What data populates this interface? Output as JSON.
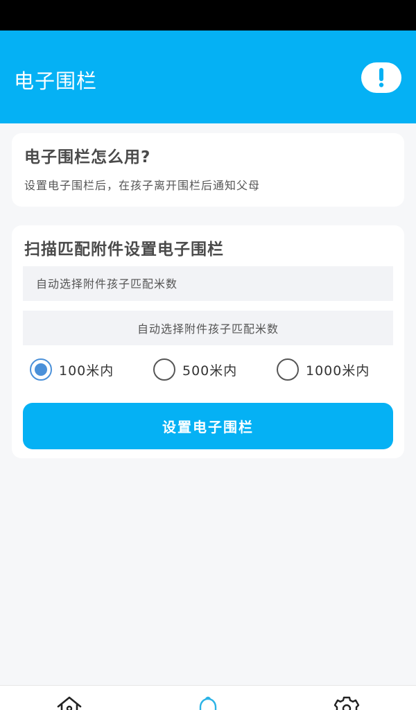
{
  "header": {
    "title": "电子围栏",
    "info_icon": "exclamation-icon"
  },
  "help_card": {
    "title": "电子围栏怎么用?",
    "description": "设置电子围栏后，在孩子离开围栏后通知父母"
  },
  "fence_card": {
    "title": "扫描匹配附件设置电子围栏",
    "input_placeholder": "自动选择附件孩子匹配米数",
    "select_value": "自动选择附件孩子匹配米数",
    "radio_options": [
      {
        "label": "100米内",
        "checked": true
      },
      {
        "label": "500米内",
        "checked": false
      },
      {
        "label": "1000米内",
        "checked": false
      }
    ],
    "submit_label": "设置电子围栏"
  },
  "bottom_nav": {
    "items": [
      {
        "icon": "home-icon"
      },
      {
        "icon": "bell-icon",
        "active": true
      },
      {
        "icon": "gear-icon"
      }
    ]
  },
  "colors": {
    "primary": "#05b1f4",
    "radio_accent": "#4a90d9",
    "background": "#f6f7f9"
  }
}
